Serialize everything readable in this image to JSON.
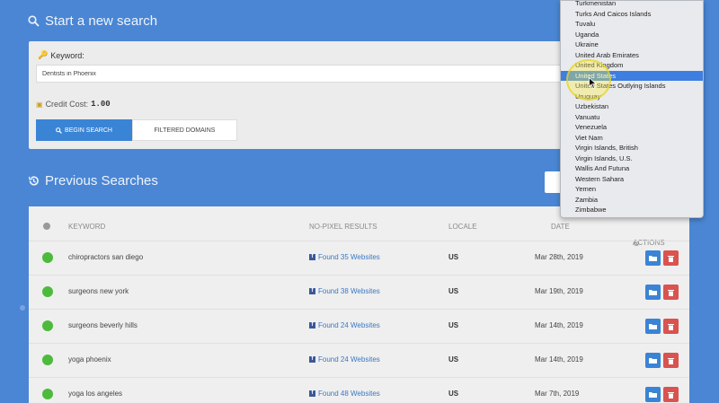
{
  "new_search": {
    "title": "Start a new search",
    "keyword_label": "Keyword:",
    "keyword_value": "Dentists in Phoenix",
    "credit_label": "Credit Cost:",
    "credit_value": "1.00",
    "begin_button": "BEGIN SEARCH",
    "filtered_button": "FILTERED DOMAINS"
  },
  "previous": {
    "title": "Previous Searches",
    "headers": {
      "keyword": "KEYWORD",
      "results": "NO-PIXEL RESULTS",
      "locale": "LOCALE",
      "date": "DATE",
      "actions": "ACTIONS"
    },
    "rows": [
      {
        "keyword": "chiropractors san diego",
        "results": "Found 35 Websites",
        "locale": "US",
        "date": "Mar 28th, 2019"
      },
      {
        "keyword": "surgeons new york",
        "results": "Found 38 Websites",
        "locale": "US",
        "date": "Mar 19th, 2019"
      },
      {
        "keyword": "surgeons beverly hills",
        "results": "Found 24 Websites",
        "locale": "US",
        "date": "Mar 14th, 2019"
      },
      {
        "keyword": "yoga phoenix",
        "results": "Found 24 Websites",
        "locale": "US",
        "date": "Mar 14th, 2019"
      },
      {
        "keyword": "yoga los angeles",
        "results": "Found 48 Websites",
        "locale": "US",
        "date": "Mar 7th, 2019"
      }
    ]
  },
  "country_dropdown": {
    "selected": "United States",
    "items": [
      "Turkmenistan",
      "Turks And Caicos Islands",
      "Tuvalu",
      "Uganda",
      "Ukraine",
      "United Arab Emirates",
      "United Kingdom",
      "United States",
      "United States Outlying Islands",
      "Uruguay",
      "Uzbekistan",
      "Vanuatu",
      "Venezuela",
      "Viet Nam",
      "Virgin Islands, British",
      "Virgin Islands, U.S.",
      "Wallis And Futuna",
      "Western Sahara",
      "Yemen",
      "Zambia",
      "Zimbabwe"
    ]
  },
  "colors": {
    "background": "#4a86d4",
    "primary_button": "#3a84d6",
    "delete_button": "#d9534f",
    "status_ok": "#4cbb3c",
    "dropdown_selected": "#3d7ee0"
  },
  "icons": {
    "new_search": "search-icon",
    "previous": "history-icon",
    "keyword": "key-icon",
    "credit": "coin-icon",
    "results": "facebook-icon",
    "actions": "gear-icon",
    "open": "folder-icon",
    "delete": "trash-icon"
  }
}
